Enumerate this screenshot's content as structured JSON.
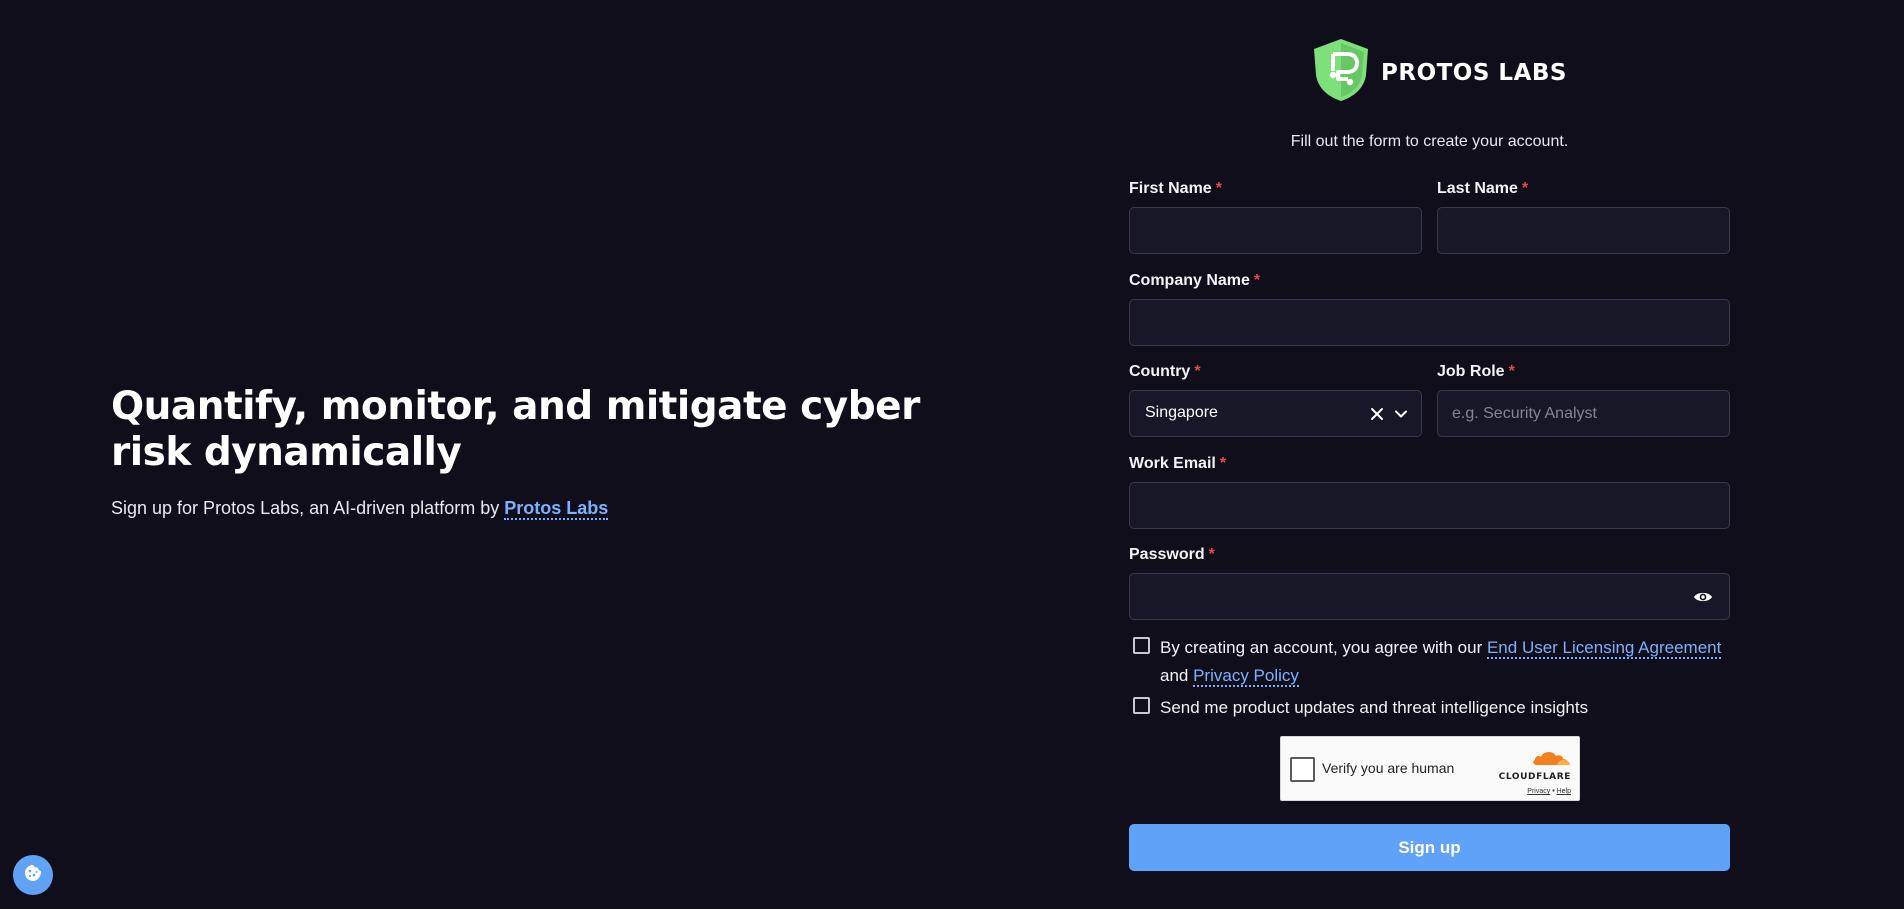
{
  "hero": {
    "headline": "Quantify, monitor, and mitigate cyber risk dynamically",
    "tagline_prefix": "Sign up for Protos Labs, an AI-driven platform by ",
    "tagline_link": "Protos Labs"
  },
  "brand": {
    "name": "PROTOS LABS",
    "logo_icon": "shield-logo-icon",
    "logo_color": "#7de07a"
  },
  "form": {
    "subtitle": "Fill out the form to create your account.",
    "required_mark": "*",
    "first_name": {
      "label": "First Name",
      "value": "",
      "placeholder": ""
    },
    "last_name": {
      "label": "Last Name",
      "value": "",
      "placeholder": ""
    },
    "company_name": {
      "label": "Company Name",
      "value": "",
      "placeholder": ""
    },
    "country": {
      "label": "Country",
      "value": "Singapore",
      "clear_icon": "close-icon",
      "dropdown_icon": "chevron-down-icon"
    },
    "job_role": {
      "label": "Job Role",
      "value": "",
      "placeholder": "e.g. Security Analyst"
    },
    "work_email": {
      "label": "Work Email",
      "value": "",
      "placeholder": ""
    },
    "password": {
      "label": "Password",
      "value": "",
      "placeholder": "",
      "toggle_icon": "eye-icon"
    },
    "agreement": {
      "prefix": "By creating an account, you agree with our ",
      "eula_link": "End User Licensing Agreement",
      "middle": "and ",
      "privacy_link": "Privacy Policy",
      "checked": false
    },
    "updates": {
      "label": "Send me product updates and threat intelligence insights",
      "checked": false
    },
    "captcha": {
      "label": "Verify you are human",
      "provider": "CLOUDFLARE",
      "privacy": "Privacy",
      "separator": "•",
      "help": "Help"
    },
    "submit_label": "Sign up"
  },
  "cookie_button": {
    "icon": "cookie-icon"
  },
  "colors": {
    "background": "#0f0e1a",
    "accent": "#5fa2f7",
    "link": "#7eb0ff",
    "required": "#e5484d",
    "input_bg": "#181727"
  }
}
